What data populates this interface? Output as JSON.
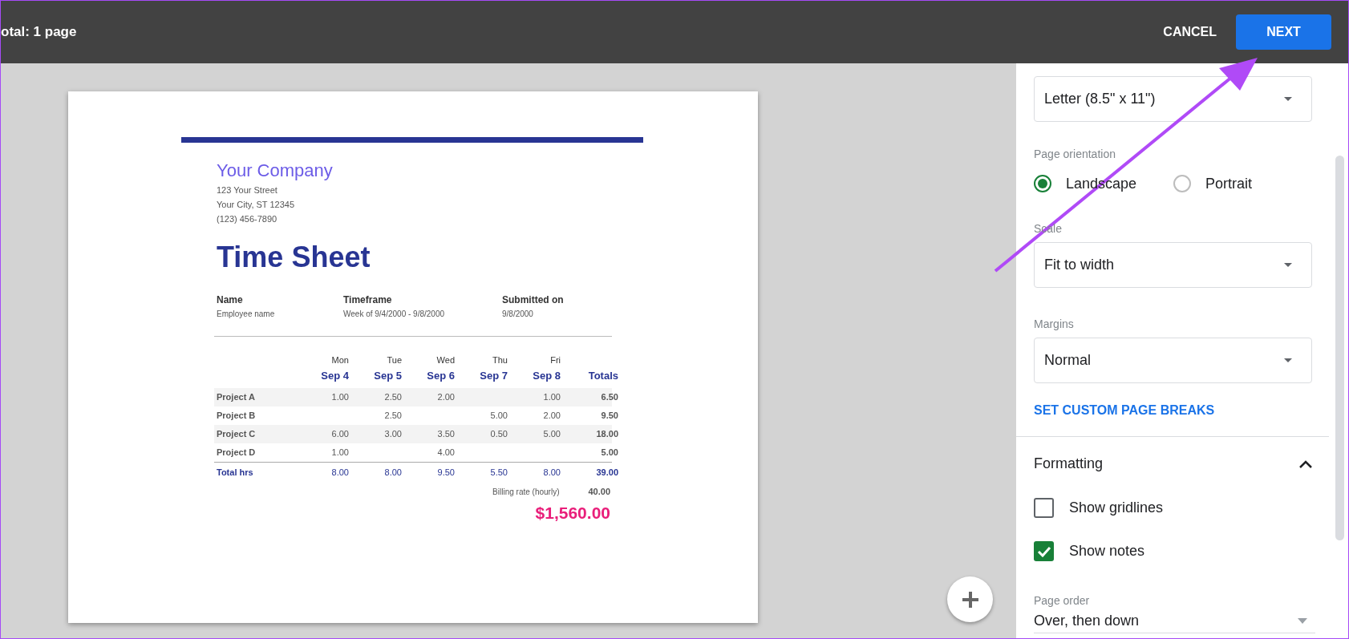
{
  "top_bar": {
    "title": "otal: 1 page",
    "buttons": [
      {
        "label": "CANCEL",
        "kind": "text"
      },
      {
        "label": "NEXT",
        "kind": "primary"
      }
    ]
  },
  "document": {
    "company": "Your Company",
    "address_lines": [
      "123 Your Street",
      "Your City, ST 12345",
      "(123) 456-7890"
    ],
    "title": "Time Sheet",
    "info": [
      {
        "label": "Name",
        "value": "Employee name"
      },
      {
        "label": "Timeframe",
        "value": "Week of 9/4/2000 - 9/8/2000"
      },
      {
        "label": "Submitted on",
        "value": "9/8/2000"
      }
    ],
    "table": {
      "columns": [
        {
          "day": "Mon",
          "date": "Sep 4"
        },
        {
          "day": "Tue",
          "date": "Sep 5"
        },
        {
          "day": "Wed",
          "date": "Sep 6"
        },
        {
          "day": "Thu",
          "date": "Sep 7"
        },
        {
          "day": "Fri",
          "date": "Sep 8"
        }
      ],
      "totals_heading": "Totals",
      "rows": [
        {
          "label": "Project A",
          "cells": [
            "1.00",
            "2.50",
            "2.00",
            "",
            "1.00"
          ],
          "total": "6.50"
        },
        {
          "label": "Project B",
          "cells": [
            "",
            "2.50",
            "",
            "5.00",
            "2.00"
          ],
          "total": "9.50"
        },
        {
          "label": "Project C",
          "cells": [
            "6.00",
            "3.00",
            "3.50",
            "0.50",
            "5.00"
          ],
          "total": "18.00"
        },
        {
          "label": "Project D",
          "cells": [
            "1.00",
            "",
            "4.00",
            "",
            ""
          ],
          "total": "5.00"
        }
      ],
      "total_row": {
        "label": "Total hrs",
        "cells": [
          "8.00",
          "8.00",
          "9.50",
          "5.50",
          "8.00"
        ],
        "total": "39.00"
      },
      "billing": {
        "label": "Billing rate (hourly)",
        "value": "40.00"
      },
      "amount": "$1,560.00"
    }
  },
  "sidebar": {
    "paper_size": {
      "value": "Letter (8.5\" x 11\")"
    },
    "orientation": {
      "label": "Page orientation",
      "options": [
        {
          "label": "Landscape",
          "selected": true
        },
        {
          "label": "Portrait",
          "selected": false
        }
      ]
    },
    "scale": {
      "label": "Scale",
      "value": "Fit to width"
    },
    "margins": {
      "label": "Margins",
      "value": "Normal"
    },
    "link": "SET CUSTOM PAGE BREAKS",
    "formatting": {
      "title": "Formatting",
      "expanded": true,
      "options": [
        {
          "label": "Show gridlines",
          "checked": false
        },
        {
          "label": "Show notes",
          "checked": true
        }
      ]
    },
    "page_order": {
      "label": "Page order",
      "value": "Over, then down"
    }
  }
}
